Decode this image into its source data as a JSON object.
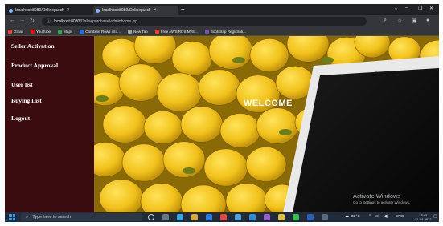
{
  "browser": {
    "tabs": [
      {
        "title": "localhost:8080/Onlinepurchase/",
        "active": false
      },
      {
        "title": "localhost:8080/Onlinepurchase/",
        "active": true
      }
    ],
    "new_tab_glyph": "+",
    "url_host": "localhost:8080",
    "url_path": "/Onlinepurchase/adminhome.jsp",
    "bookmarks": [
      {
        "label": "Gmail",
        "color": "#ea4335"
      },
      {
        "label": "YouTube",
        "color": "#ff0000"
      },
      {
        "label": "Maps",
        "color": "#34a853"
      },
      {
        "label": "Combine Rows into...",
        "color": "#1a73e8"
      },
      {
        "label": "New Tab",
        "color": "#9aa0a6"
      },
      {
        "label": "Free AWS RDS MyS...",
        "color": "#ff3b30"
      },
      {
        "label": "Bootstrap Registrati...",
        "color": "#7952b3"
      }
    ]
  },
  "sidebar": {
    "items": [
      {
        "label": "Seller Activation"
      },
      {
        "label": "Product Approval"
      },
      {
        "label": "User list"
      },
      {
        "label": "Buying List"
      },
      {
        "label": "Logout"
      }
    ]
  },
  "hero": {
    "welcome_text": "WELCOME"
  },
  "watermark": {
    "title": "Activate Windows",
    "subtitle": "Go to Settings to activate Windows."
  },
  "taskbar": {
    "search_placeholder": "Type here to search",
    "temperature": "32°C",
    "language": "ENG",
    "time": "18:45",
    "date": "21-04-2022"
  },
  "colors": {
    "sidebar_bg": "#3a0c10",
    "lemon": "#f2c21b",
    "taskbar": "#1f2a3a"
  }
}
